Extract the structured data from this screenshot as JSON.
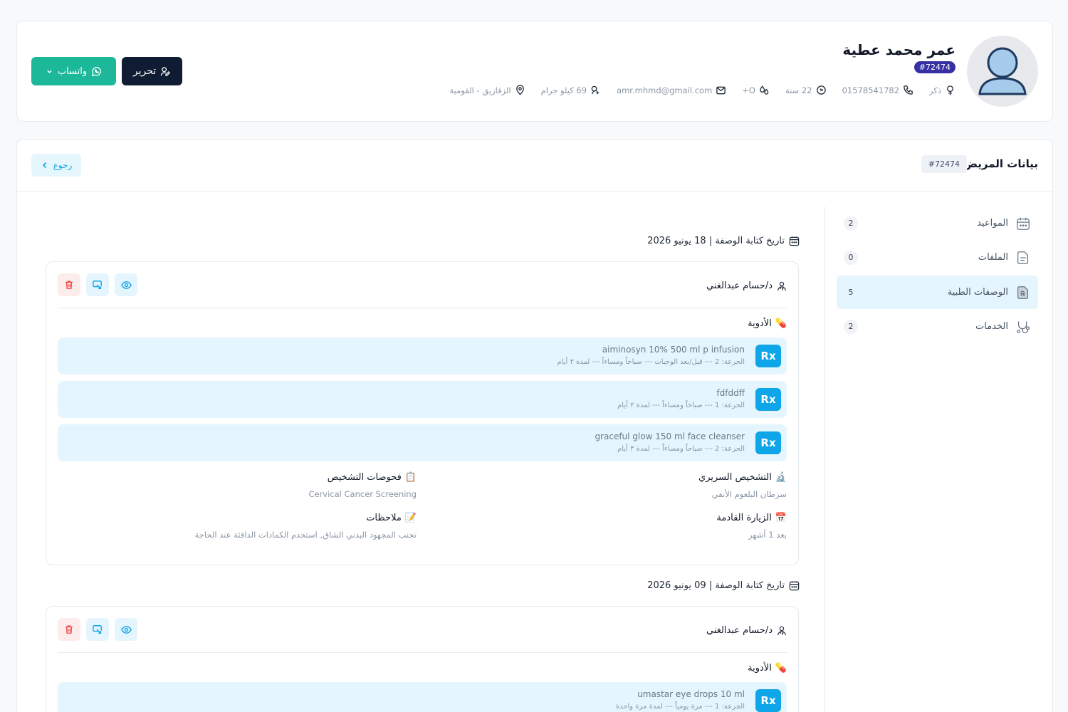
{
  "patient": {
    "name": "عمر محمد عطية",
    "id": "#72474",
    "gender": "ذكر",
    "phone": "01578541782",
    "age": "22 سنة",
    "blood_type": "O+",
    "email": "amr.mhmd@gmail.com",
    "weight": "69 كيلو جرام",
    "location": "الزقازيق - القومية"
  },
  "actions": {
    "edit": "تحرير",
    "whatsapp": "واتساب"
  },
  "section": {
    "title": "بيانات المريض",
    "id": "#72474",
    "back": "رجوع"
  },
  "sidebar": [
    {
      "label": "المواعيد",
      "count": "2",
      "icon": "calendar-icon"
    },
    {
      "label": "الملفات",
      "count": "0",
      "icon": "file-icon"
    },
    {
      "label": "الوصفات الطبية",
      "count": "5",
      "icon": "prescription-icon",
      "active": true
    },
    {
      "label": "الخدمات",
      "count": "2",
      "icon": "stethoscope-icon"
    }
  ],
  "prescriptions": [
    {
      "date_label": "تاريخ كتابة الوصفة | 18 يونيو 2026",
      "doctor": "د/حسام عبدالغني",
      "meds_title": "الأدوية",
      "meds": [
        {
          "name": "aiminosyn 10% 500 ml p infusion",
          "detail": "الجرعة: 2 --- قبل/بعد الوجبات --- صباحاً ومساءاً --- لمدة ٣ أيام"
        },
        {
          "name": "fdfddff",
          "detail": "الجرعة: 1 --- صباحاً ومساءاً --- لمدة ٣ أيام"
        },
        {
          "name": "graceful glow 150 ml face cleanser",
          "detail": "الجرعة: 2 --- صباحاً ومساءاً --- لمدة ٣ أيام"
        }
      ],
      "diagnosis_title": "التشخيص السريري",
      "diagnosis": "سرطان البلعوم الأنفي",
      "tests_title": "فحوصات التشخيص",
      "tests": "Cervical Cancer Screening",
      "next_visit_title": "الزيارة القادمة",
      "next_visit": "بعد 1 أشهر",
      "notes_title": "ملاحظات",
      "notes": "تجنب المجهود البدني الشاق, استخدم الكمادات الدافئة عند الحاجة"
    },
    {
      "date_label": "تاريخ كتابة الوصفة | 09 يونيو 2026",
      "doctor": "د/حسام عبدالغني",
      "meds_title": "الأدوية",
      "meds": [
        {
          "name": "umastar eye drops 10 ml",
          "detail": "الجرعة: 1 --- مرة يومياً --- لمدة مرة واحدة"
        }
      ]
    }
  ],
  "rx_badge": "Rx",
  "colors": {
    "primary_dark": "#0f1c33",
    "whatsapp": "#1db89a",
    "accent": "#0ea5e9",
    "id_badge": "#3730a3"
  }
}
